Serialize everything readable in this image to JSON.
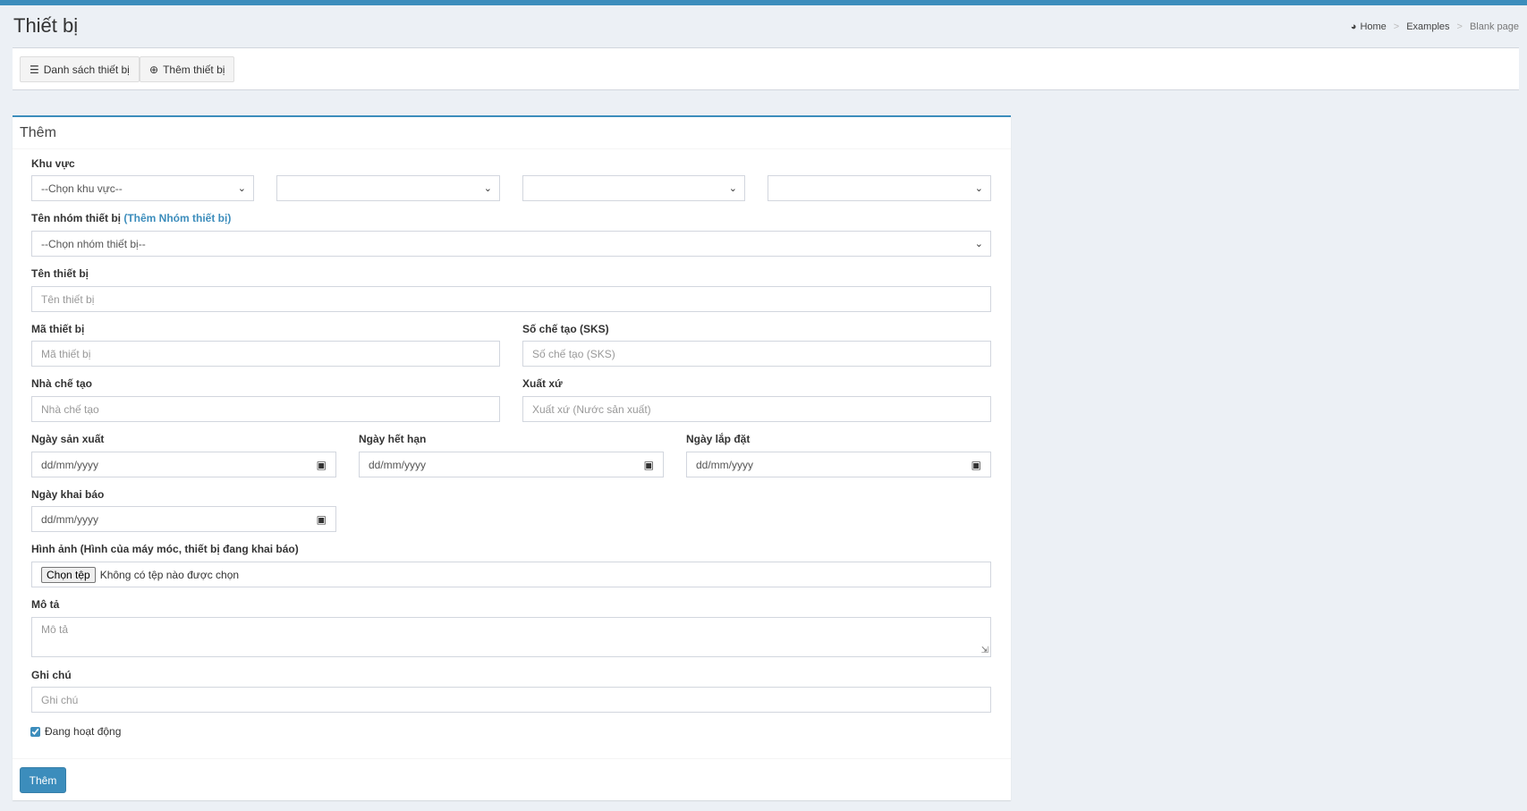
{
  "page": {
    "title": "Thiết bị"
  },
  "breadcrumb": {
    "home": "Home",
    "examples": "Examples",
    "current": "Blank page"
  },
  "toolbar": {
    "list_label": "Danh sách thiết bị",
    "add_label": "Thêm thiết bị"
  },
  "form": {
    "box_title": "Thêm",
    "khu_vuc": {
      "label": "Khu vực",
      "select1": "--Chọn khu vực--"
    },
    "nhom": {
      "label": "Tên nhóm thiết bị",
      "link": "(Thêm Nhóm thiết bị)",
      "select": "--Chọn nhóm thiết bị--"
    },
    "ten": {
      "label": "Tên thiết bị",
      "placeholder": "Tên thiết bị"
    },
    "ma": {
      "label": "Mã thiết bị",
      "placeholder": "Mã thiết bị"
    },
    "sks": {
      "label": "Số chế tạo (SKS)",
      "placeholder": "Số chế tạo (SKS)"
    },
    "nha_che_tao": {
      "label": "Nhà chế tạo",
      "placeholder": "Nhà chế tạo"
    },
    "xuat_xu": {
      "label": "Xuất xứ",
      "placeholder": "Xuất xứ (Nước sản xuất)"
    },
    "ngay_san_xuat": {
      "label": "Ngày sản xuất",
      "value": "dd/mm/yyyy"
    },
    "ngay_het_han": {
      "label": "Ngày hết hạn",
      "value": "dd/mm/yyyy"
    },
    "ngay_lap_dat": {
      "label": "Ngày lắp đặt",
      "value": "dd/mm/yyyy"
    },
    "ngay_khai_bao": {
      "label": "Ngày khai báo",
      "value": "dd/mm/yyyy"
    },
    "hinh_anh": {
      "label": "Hình ảnh (Hình của máy móc, thiết bị đang khai báo)",
      "button": "Chọn tệp",
      "status": "Không có tệp nào được chọn"
    },
    "mo_ta": {
      "label": "Mô tả",
      "placeholder": "Mô tả"
    },
    "ghi_chu": {
      "label": "Ghi chú",
      "placeholder": "Ghi chú"
    },
    "active": {
      "label": "Đang hoạt động",
      "checked": true
    },
    "submit": "Thêm"
  },
  "colors": {
    "primary": "#3c8dbc",
    "background": "#ecf0f5"
  }
}
